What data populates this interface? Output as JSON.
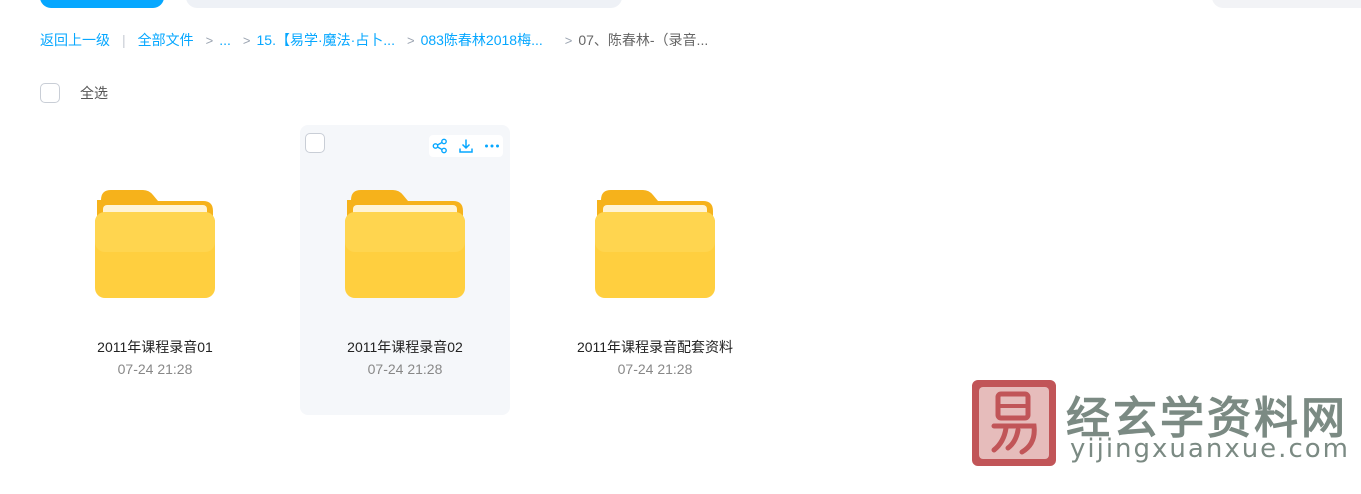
{
  "breadcrumb": {
    "back": "返回上一级",
    "separator": "|",
    "items": [
      {
        "label": "全部文件"
      },
      {
        "label": "..."
      },
      {
        "label": "15.【易学·魔法·占卜..."
      },
      {
        "label": "083陈春林2018梅..."
      }
    ],
    "current": "07、陈春林-（录音..."
  },
  "select_all": {
    "label": "全选"
  },
  "folders": [
    {
      "name": "2011年课程录音01",
      "time": "07-24 21:28"
    },
    {
      "name": "2011年课程录音02",
      "time": "07-24 21:28"
    },
    {
      "name": "2011年课程录音配套资料",
      "time": "07-24 21:28"
    }
  ],
  "icons": {
    "folder": "folder-icon",
    "share": "share-icon",
    "download": "download-icon",
    "more": "more-icon",
    "chevron": "chevron-right-icon"
  },
  "colors": {
    "accent": "#06a7ff",
    "folder_back": "#f6b21b",
    "folder_front": "#ffcf3f",
    "hover_bg": "#f5f7fa",
    "watermark": "#7b8a83",
    "seal": "#b7383b"
  },
  "watermark": {
    "title": "经玄学资料网",
    "url": "yijingxuanxue.com",
    "seal_char": "易"
  }
}
